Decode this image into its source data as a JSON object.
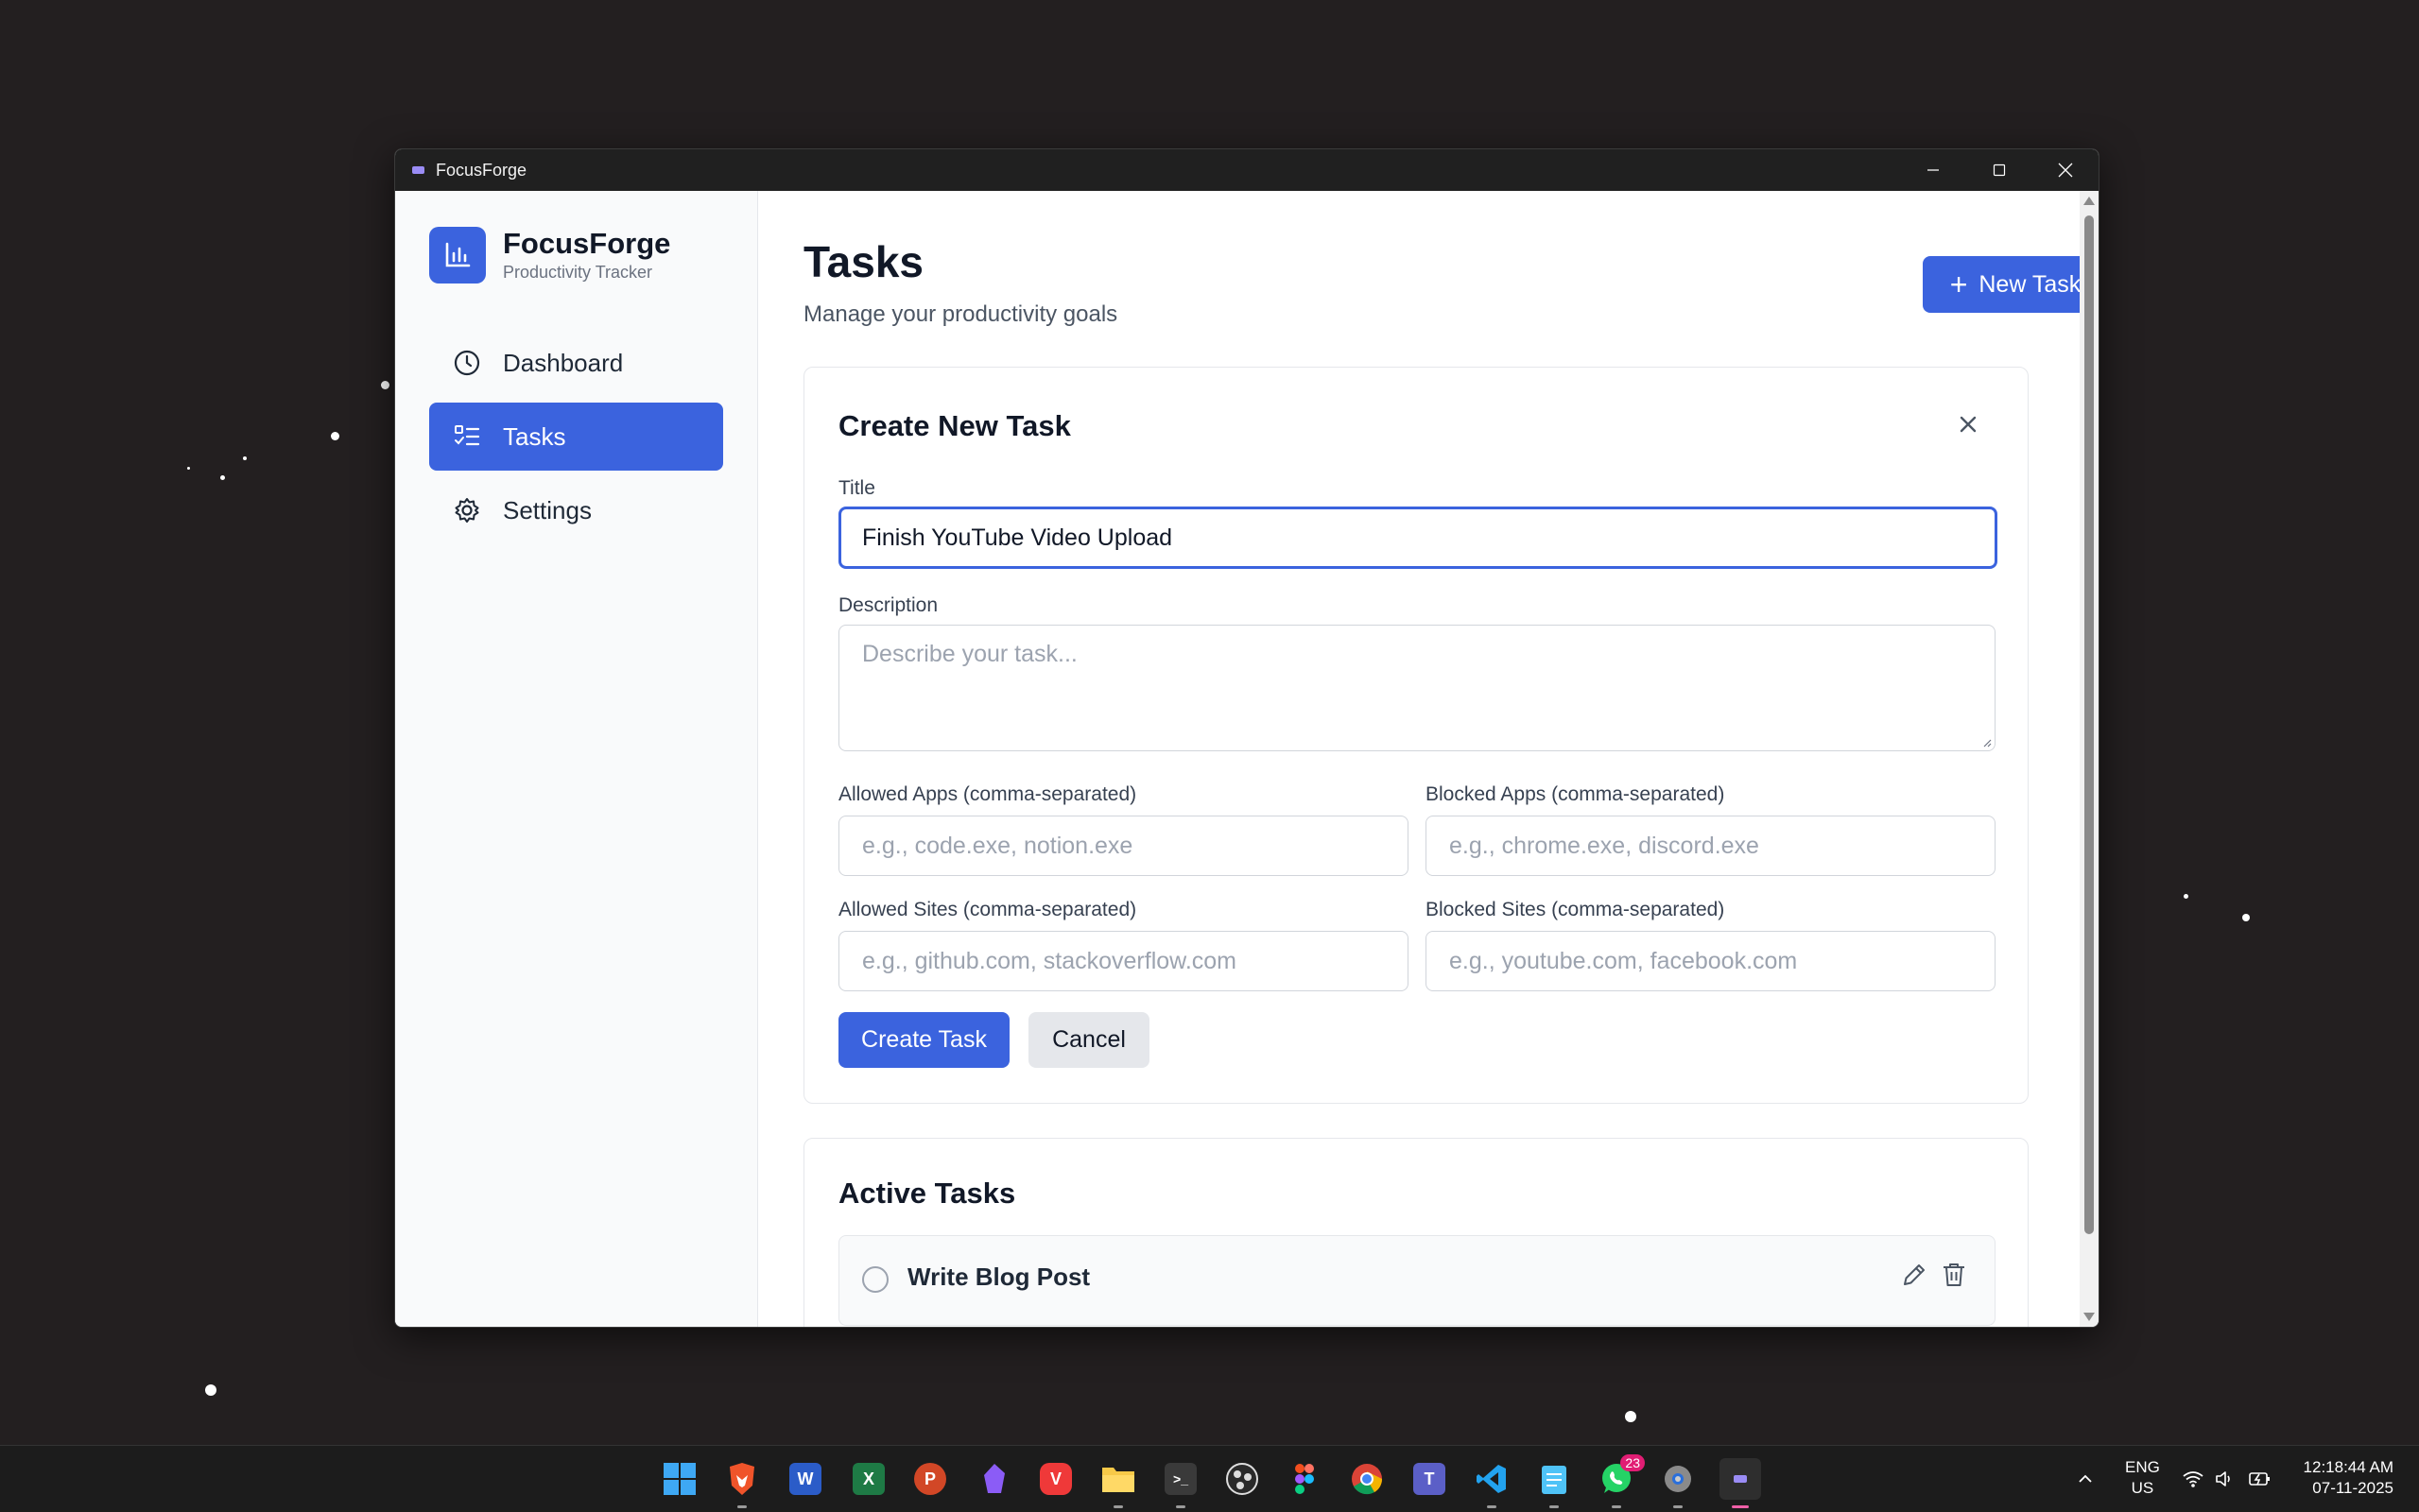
{
  "window": {
    "title": "FocusForge"
  },
  "sidebar": {
    "brand_name": "FocusForge",
    "brand_sub": "Productivity Tracker",
    "items": [
      {
        "label": "Dashboard",
        "icon": "clock-icon"
      },
      {
        "label": "Tasks",
        "icon": "list-check-icon",
        "active": true
      },
      {
        "label": "Settings",
        "icon": "gear-icon"
      }
    ]
  },
  "header": {
    "title": "Tasks",
    "subtitle": "Manage your productivity goals",
    "new_task_label": "New Task"
  },
  "form": {
    "title": "Create New Task",
    "title_label": "Title",
    "title_value": "Finish YouTube Video Upload",
    "description_label": "Description",
    "description_placeholder": "Describe your task...",
    "allowed_apps_label": "Allowed Apps (comma-separated)",
    "allowed_apps_placeholder": "e.g., code.exe, notion.exe",
    "blocked_apps_label": "Blocked Apps (comma-separated)",
    "blocked_apps_placeholder": "e.g., chrome.exe, discord.exe",
    "allowed_sites_label": "Allowed Sites (comma-separated)",
    "allowed_sites_placeholder": "e.g., github.com, stackoverflow.com",
    "blocked_sites_label": "Blocked Sites (comma-separated)",
    "blocked_sites_placeholder": "e.g., youtube.com, facebook.com",
    "create_label": "Create Task",
    "cancel_label": "Cancel"
  },
  "active_tasks": {
    "title": "Active Tasks",
    "tasks": [
      {
        "name": "Write Blog Post"
      }
    ]
  },
  "taskbar": {
    "whatsapp_badge": "23",
    "lang_line1": "ENG",
    "lang_line2": "US",
    "time": "12:18:44 AM",
    "date": "07-11-2025"
  },
  "colors": {
    "accent": "#3b63de",
    "desktop": "#231f20"
  }
}
